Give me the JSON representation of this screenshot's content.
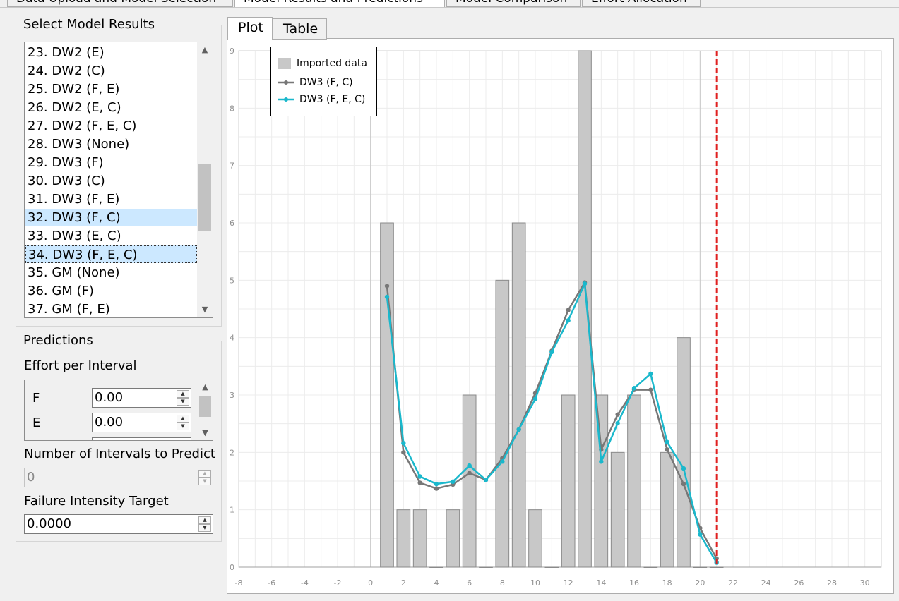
{
  "top_tabs": [
    "Data Upload and Model Selection",
    "Model Results and Predictions",
    "Model Comparison",
    "Effort Allocation"
  ],
  "model_results": {
    "title": "Select Model Results",
    "items": [
      {
        "label": "23. DW2 (E)",
        "selected": false
      },
      {
        "label": "24. DW2 (C)",
        "selected": false
      },
      {
        "label": "25. DW2 (F, E)",
        "selected": false
      },
      {
        "label": "26. DW2 (E, C)",
        "selected": false
      },
      {
        "label": "27. DW2 (F, E, C)",
        "selected": false
      },
      {
        "label": "28. DW3 (None)",
        "selected": false
      },
      {
        "label": "29. DW3 (F)",
        "selected": false
      },
      {
        "label": "30. DW3 (C)",
        "selected": false
      },
      {
        "label": "31. DW3 (F, E)",
        "selected": false
      },
      {
        "label": "32. DW3 (F, C)",
        "selected": true
      },
      {
        "label": "33. DW3 (E, C)",
        "selected": false
      },
      {
        "label": "34. DW3 (F, E, C)",
        "selected": true
      },
      {
        "label": "35. GM (None)",
        "selected": false
      },
      {
        "label": "36. GM (F)",
        "selected": false
      },
      {
        "label": "37. GM (F, E)",
        "selected": false
      }
    ]
  },
  "predictions": {
    "title": "Predictions",
    "effort_label": "Effort per Interval",
    "effort_rows": [
      {
        "name": "F",
        "value": "0.00"
      },
      {
        "name": "E",
        "value": "0.00"
      }
    ],
    "intervals_label": "Number of Intervals to Predict",
    "intervals_value": "0",
    "intensity_label": "Failure Intensity Target",
    "intensity_value": "0.0000"
  },
  "plot_tabs": [
    "Plot",
    "Table"
  ],
  "colors": {
    "bar": "#c8c8c8",
    "series1": "#777777",
    "series2": "#1ab8cc",
    "marker_line": "#e02020"
  },
  "chart_data": {
    "type": "bar",
    "xlim": [
      -8,
      31
    ],
    "ylim": [
      0,
      9
    ],
    "x_ticks": [
      "-8",
      "-6",
      "-4",
      "-2",
      "0",
      "2",
      "4",
      "6",
      "8",
      "10",
      "12",
      "14",
      "16",
      "18",
      "20",
      "22",
      "24",
      "26",
      "28",
      "30"
    ],
    "y_ticks": [
      "0",
      "1",
      "2",
      "3",
      "4",
      "5",
      "6",
      "7",
      "8",
      "9"
    ],
    "grid": true,
    "legend": "top-left",
    "bars": {
      "name": "Imported data",
      "x": [
        1,
        2,
        3,
        4,
        5,
        6,
        7,
        8,
        9,
        10,
        11,
        12,
        13,
        14,
        15,
        16,
        17,
        18,
        19,
        20,
        21
      ],
      "values": [
        6,
        1,
        1,
        0,
        1,
        3,
        0,
        5,
        6,
        1,
        0,
        3,
        9,
        3,
        2,
        3,
        0,
        2,
        4,
        0,
        0
      ]
    },
    "series": [
      {
        "name": "DW3 (F, C)",
        "x": [
          1,
          2,
          3,
          4,
          5,
          6,
          7,
          8,
          9,
          10,
          11,
          12,
          13,
          14,
          15,
          16,
          17,
          18,
          19,
          20,
          21
        ],
        "values": [
          4.9,
          2.0,
          1.47,
          1.37,
          1.44,
          1.64,
          1.52,
          1.9,
          2.4,
          3.03,
          3.77,
          4.48,
          4.96,
          2.05,
          2.66,
          3.09,
          3.09,
          2.05,
          1.45,
          0.68,
          0.15
        ]
      },
      {
        "name": "DW3 (F, E, C)",
        "x": [
          1,
          2,
          3,
          4,
          5,
          6,
          7,
          8,
          9,
          10,
          11,
          12,
          13,
          14,
          15,
          16,
          17,
          18,
          19,
          20,
          21
        ],
        "values": [
          4.71,
          2.16,
          1.58,
          1.45,
          1.49,
          1.77,
          1.52,
          1.84,
          2.4,
          2.93,
          3.75,
          4.3,
          4.94,
          1.84,
          2.51,
          3.12,
          3.37,
          2.18,
          1.72,
          0.57,
          0.08
        ]
      }
    ],
    "vline_x": 21
  }
}
